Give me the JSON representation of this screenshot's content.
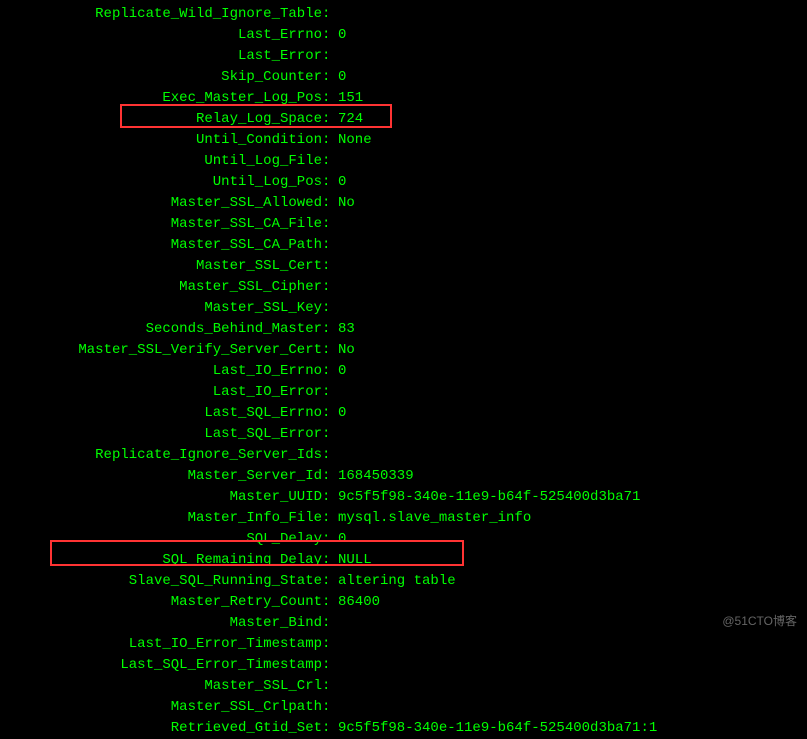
{
  "rows": [
    {
      "label": "",
      "value": ""
    },
    {
      "label": "Replicate_Wild_Ignore_Table",
      "value": ""
    },
    {
      "label": "Last_Errno",
      "value": "0"
    },
    {
      "label": "Last_Error",
      "value": ""
    },
    {
      "label": "Skip_Counter",
      "value": "0"
    },
    {
      "label": "Exec_Master_Log_Pos",
      "value": "151"
    },
    {
      "label": "Relay_Log_Space",
      "value": "724"
    },
    {
      "label": "Until_Condition",
      "value": "None"
    },
    {
      "label": "Until_Log_File",
      "value": ""
    },
    {
      "label": "Until_Log_Pos",
      "value": "0"
    },
    {
      "label": "Master_SSL_Allowed",
      "value": "No"
    },
    {
      "label": "Master_SSL_CA_File",
      "value": ""
    },
    {
      "label": "Master_SSL_CA_Path",
      "value": ""
    },
    {
      "label": "Master_SSL_Cert",
      "value": ""
    },
    {
      "label": "Master_SSL_Cipher",
      "value": ""
    },
    {
      "label": "Master_SSL_Key",
      "value": ""
    },
    {
      "label": "Seconds_Behind_Master",
      "value": "83"
    },
    {
      "label": "Master_SSL_Verify_Server_Cert",
      "value": "No"
    },
    {
      "label": "Last_IO_Errno",
      "value": "0"
    },
    {
      "label": "Last_IO_Error",
      "value": ""
    },
    {
      "label": "Last_SQL_Errno",
      "value": "0"
    },
    {
      "label": "Last_SQL_Error",
      "value": ""
    },
    {
      "label": "Replicate_Ignore_Server_Ids",
      "value": ""
    },
    {
      "label": "Master_Server_Id",
      "value": "168450339"
    },
    {
      "label": "Master_UUID",
      "value": "9c5f5f98-340e-11e9-b64f-525400d3ba71"
    },
    {
      "label": "Master_Info_File",
      "value": "mysql.slave_master_info"
    },
    {
      "label": "SQL_Delay",
      "value": "0"
    },
    {
      "label": "SQL_Remaining_Delay",
      "value": "NULL"
    },
    {
      "label": "Slave_SQL_Running_State",
      "value": "altering table"
    },
    {
      "label": "Master_Retry_Count",
      "value": "86400"
    },
    {
      "label": "Master_Bind",
      "value": ""
    },
    {
      "label": "Last_IO_Error_Timestamp",
      "value": ""
    },
    {
      "label": "Last_SQL_Error_Timestamp",
      "value": ""
    },
    {
      "label": "Master_SSL_Crl",
      "value": ""
    },
    {
      "label": "Master_SSL_Crlpath",
      "value": ""
    },
    {
      "label": "Retrieved_Gtid_Set",
      "value": "9c5f5f98-340e-11e9-b64f-525400d3ba71:1"
    }
  ],
  "watermark": "@51CTO博客"
}
